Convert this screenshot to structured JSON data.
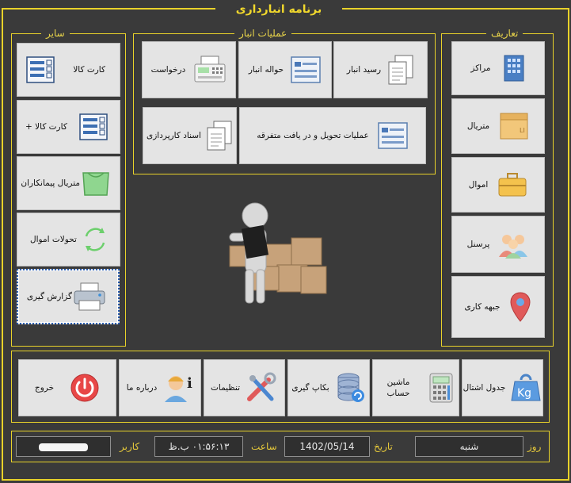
{
  "app": {
    "title": "برنامه انبارداری"
  },
  "sections": {
    "misc": "سایر",
    "operations": "عملیات انبار",
    "definitions": "تعاریف"
  },
  "misc_items": [
    {
      "label": "کارت کالا",
      "icon": "item-card-icon"
    },
    {
      "label": "کارت کالا +",
      "icon": "item-card-plus-icon"
    },
    {
      "label": "متریال پیمانکاران",
      "icon": "contractor-bag-icon"
    },
    {
      "label": "تحولات اموال",
      "icon": "recycle-icon"
    },
    {
      "label": "گزارش گیری",
      "icon": "printer-icon"
    }
  ],
  "operation_items": [
    {
      "label": "رسید انبار",
      "icon": "documents-icon"
    },
    {
      "label": "حواله انبار",
      "icon": "form-icon"
    },
    {
      "label": "درخواست",
      "icon": "fax-icon"
    },
    {
      "label": "عملیات  تحویل و در یافت متفرقه",
      "icon": "form-icon"
    },
    {
      "label": "اسناد کارپردازی",
      "icon": "documents-icon"
    }
  ],
  "definition_items": [
    {
      "label": "مراکز",
      "icon": "building-icon"
    },
    {
      "label": "متریال",
      "icon": "box-icon"
    },
    {
      "label": "اموال",
      "icon": "toolbox-icon"
    },
    {
      "label": "پرسنل",
      "icon": "people-icon"
    },
    {
      "label": "جبهه کاری",
      "icon": "map-pin-icon"
    }
  ],
  "bottom_items": [
    {
      "label": "جدول اشتال",
      "icon": "weight-icon"
    },
    {
      "label": "ماشین حساب",
      "icon": "calculator-icon"
    },
    {
      "label": "بکاپ گیری",
      "icon": "database-backup-icon"
    },
    {
      "label": "تنظیمات",
      "icon": "tools-icon"
    },
    {
      "label": "درباره ما",
      "icon": "info-person-icon"
    },
    {
      "label": "خروج",
      "icon": "power-icon"
    }
  ],
  "status": {
    "day_label": "روز",
    "day_value": "شنبه",
    "date_label": "تاریخ",
    "date_value": "1402/05/14",
    "time_label": "ساعت",
    "time_value": "۰۱:۵۶:۱۳ ب.ظ",
    "user_label": "کاربر"
  },
  "colors": {
    "accent": "#e8d22a",
    "background": "#3a3a3a",
    "tile": "#e4e4e4"
  }
}
